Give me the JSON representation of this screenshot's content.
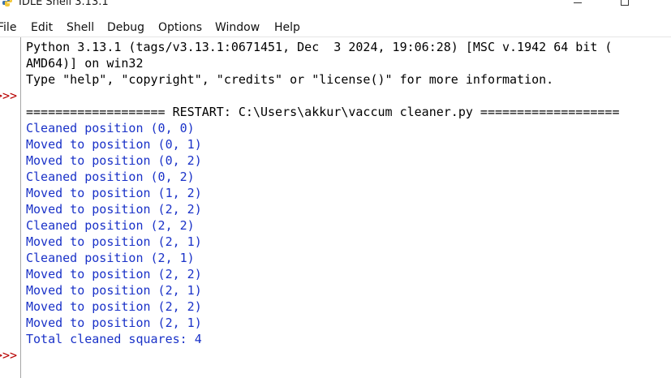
{
  "window": {
    "title": "IDLE Shell 3.13.1"
  },
  "menu": [
    {
      "key": "file",
      "label": "File"
    },
    {
      "key": "edit",
      "label": "Edit"
    },
    {
      "key": "shell",
      "label": "Shell"
    },
    {
      "key": "debug",
      "label": "Debug"
    },
    {
      "key": "options",
      "label": "Options"
    },
    {
      "key": "window",
      "label": "Window"
    },
    {
      "key": "help",
      "label": "Help"
    }
  ],
  "prompts": [
    ">>>",
    ">>>"
  ],
  "banner": [
    "Python 3.13.1 (tags/v3.13.1:0671451, Dec  3 2024, 19:06:28) [MSC v.1942 64 bit (",
    "AMD64)] on win32",
    "Type \"help\", \"copyright\", \"credits\" or \"license()\" for more information."
  ],
  "restart_line": "=================== RESTART: C:\\Users\\akkur\\vaccum cleaner.py ===================",
  "output": [
    "Cleaned position (0, 0)",
    "Moved to position (0, 1)",
    "Moved to position (0, 2)",
    "Cleaned position (0, 2)",
    "Moved to position (1, 2)",
    "Moved to position (2, 2)",
    "Cleaned position (2, 2)",
    "Moved to position (2, 1)",
    "Cleaned position (2, 1)",
    "Moved to position (2, 2)",
    "Moved to position (2, 1)",
    "Moved to position (2, 2)",
    "Moved to position (2, 1)",
    "Total cleaned squares: 4"
  ],
  "colors": {
    "stdout": "#1a32c8",
    "prompt": "#b80000",
    "text": "#000000"
  }
}
